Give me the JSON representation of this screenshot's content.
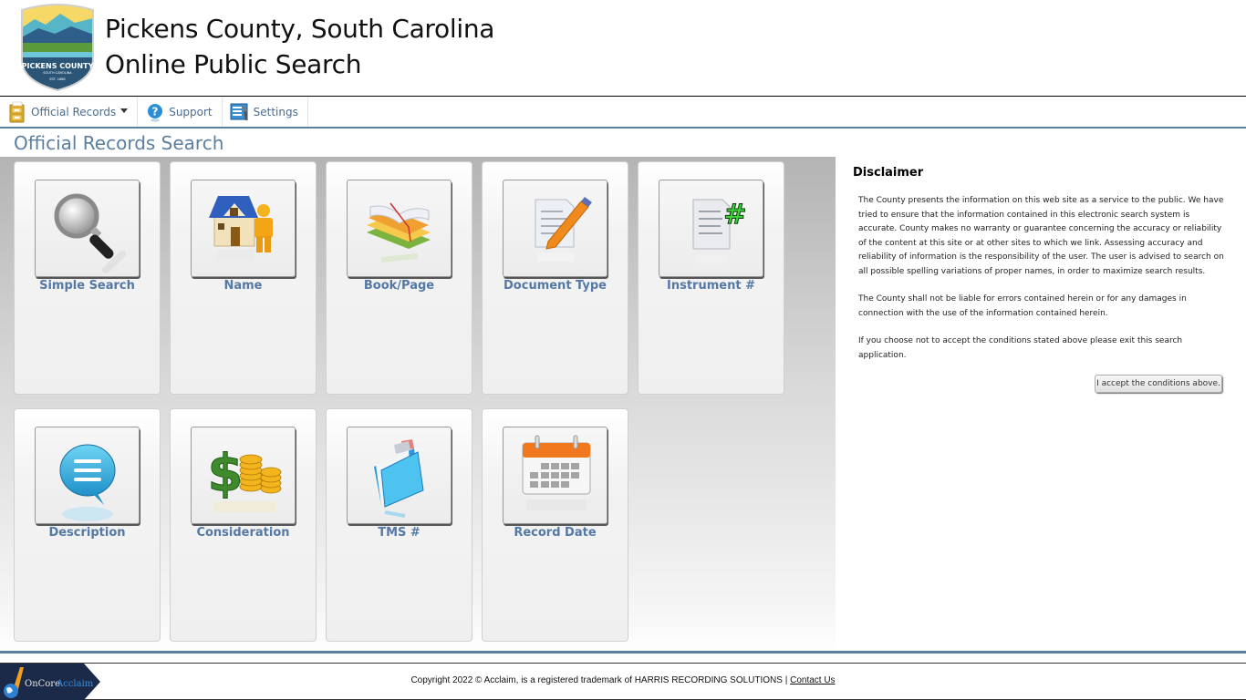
{
  "header": {
    "title_line1": "Pickens County, South Carolina",
    "title_line2": "Online Public Search",
    "logo": {
      "icon": "pickens-county-seal",
      "text": "PICKENS COUNTY",
      "subtext": "SOUTH CAROLINA",
      "est": "EST. 1868"
    }
  },
  "nav": {
    "items": [
      {
        "label": "Official Records",
        "icon": "filing-cabinet-icon",
        "has_dropdown": true
      },
      {
        "label": "Support",
        "icon": "help-icon"
      },
      {
        "label": "Settings",
        "icon": "settings-icon"
      }
    ]
  },
  "page_title": "Official Records Search",
  "tiles": [
    {
      "label": "Simple Search",
      "icon": "magnifier-icon"
    },
    {
      "label": "Name",
      "icon": "house-person-icon"
    },
    {
      "label": "Book/Page",
      "icon": "books-icon"
    },
    {
      "label": "Document Type",
      "icon": "document-pencil-icon"
    },
    {
      "label": "Instrument #",
      "icon": "document-hash-icon"
    },
    {
      "label": "Description",
      "icon": "speech-bubble-icon"
    },
    {
      "label": "Consideration",
      "icon": "dollar-coins-icon"
    },
    {
      "label": "TMS #",
      "icon": "folder-icon"
    },
    {
      "label": "Record Date",
      "icon": "calendar-icon"
    }
  ],
  "disclaimer": {
    "title": "Disclaimer",
    "paragraphs": [
      "The County presents the information on this web site as a service to the public. We have tried to ensure that the information contained in this electronic search system is accurate. County makes no warranty or guarantee concerning the accuracy or reliability of the content at this site or at other sites to which we link. Assessing accuracy and reliability of information is the responsibility of the user. The user is advised to search on all possible spelling variations of proper names, in order to maximize search results.",
      "The County shall not be liable for errors contained herein or for any damages in connection with the use of the information contained herein.",
      "If you choose not to accept the conditions stated above please exit this search application."
    ],
    "accept_label": "I accept the conditions above."
  },
  "footer": {
    "logo_text_1": "OnCore",
    "logo_text_2": "Acclaim",
    "copyright": "Copyright 2022 © Acclaim, is a registered trademark of HARRIS RECORDING SOLUTIONS | ",
    "contact_label": "Contact Us"
  },
  "colors": {
    "accent": "#5b7fa3",
    "tile_label": "#5479a5",
    "nav_text": "#4a6c8f"
  }
}
